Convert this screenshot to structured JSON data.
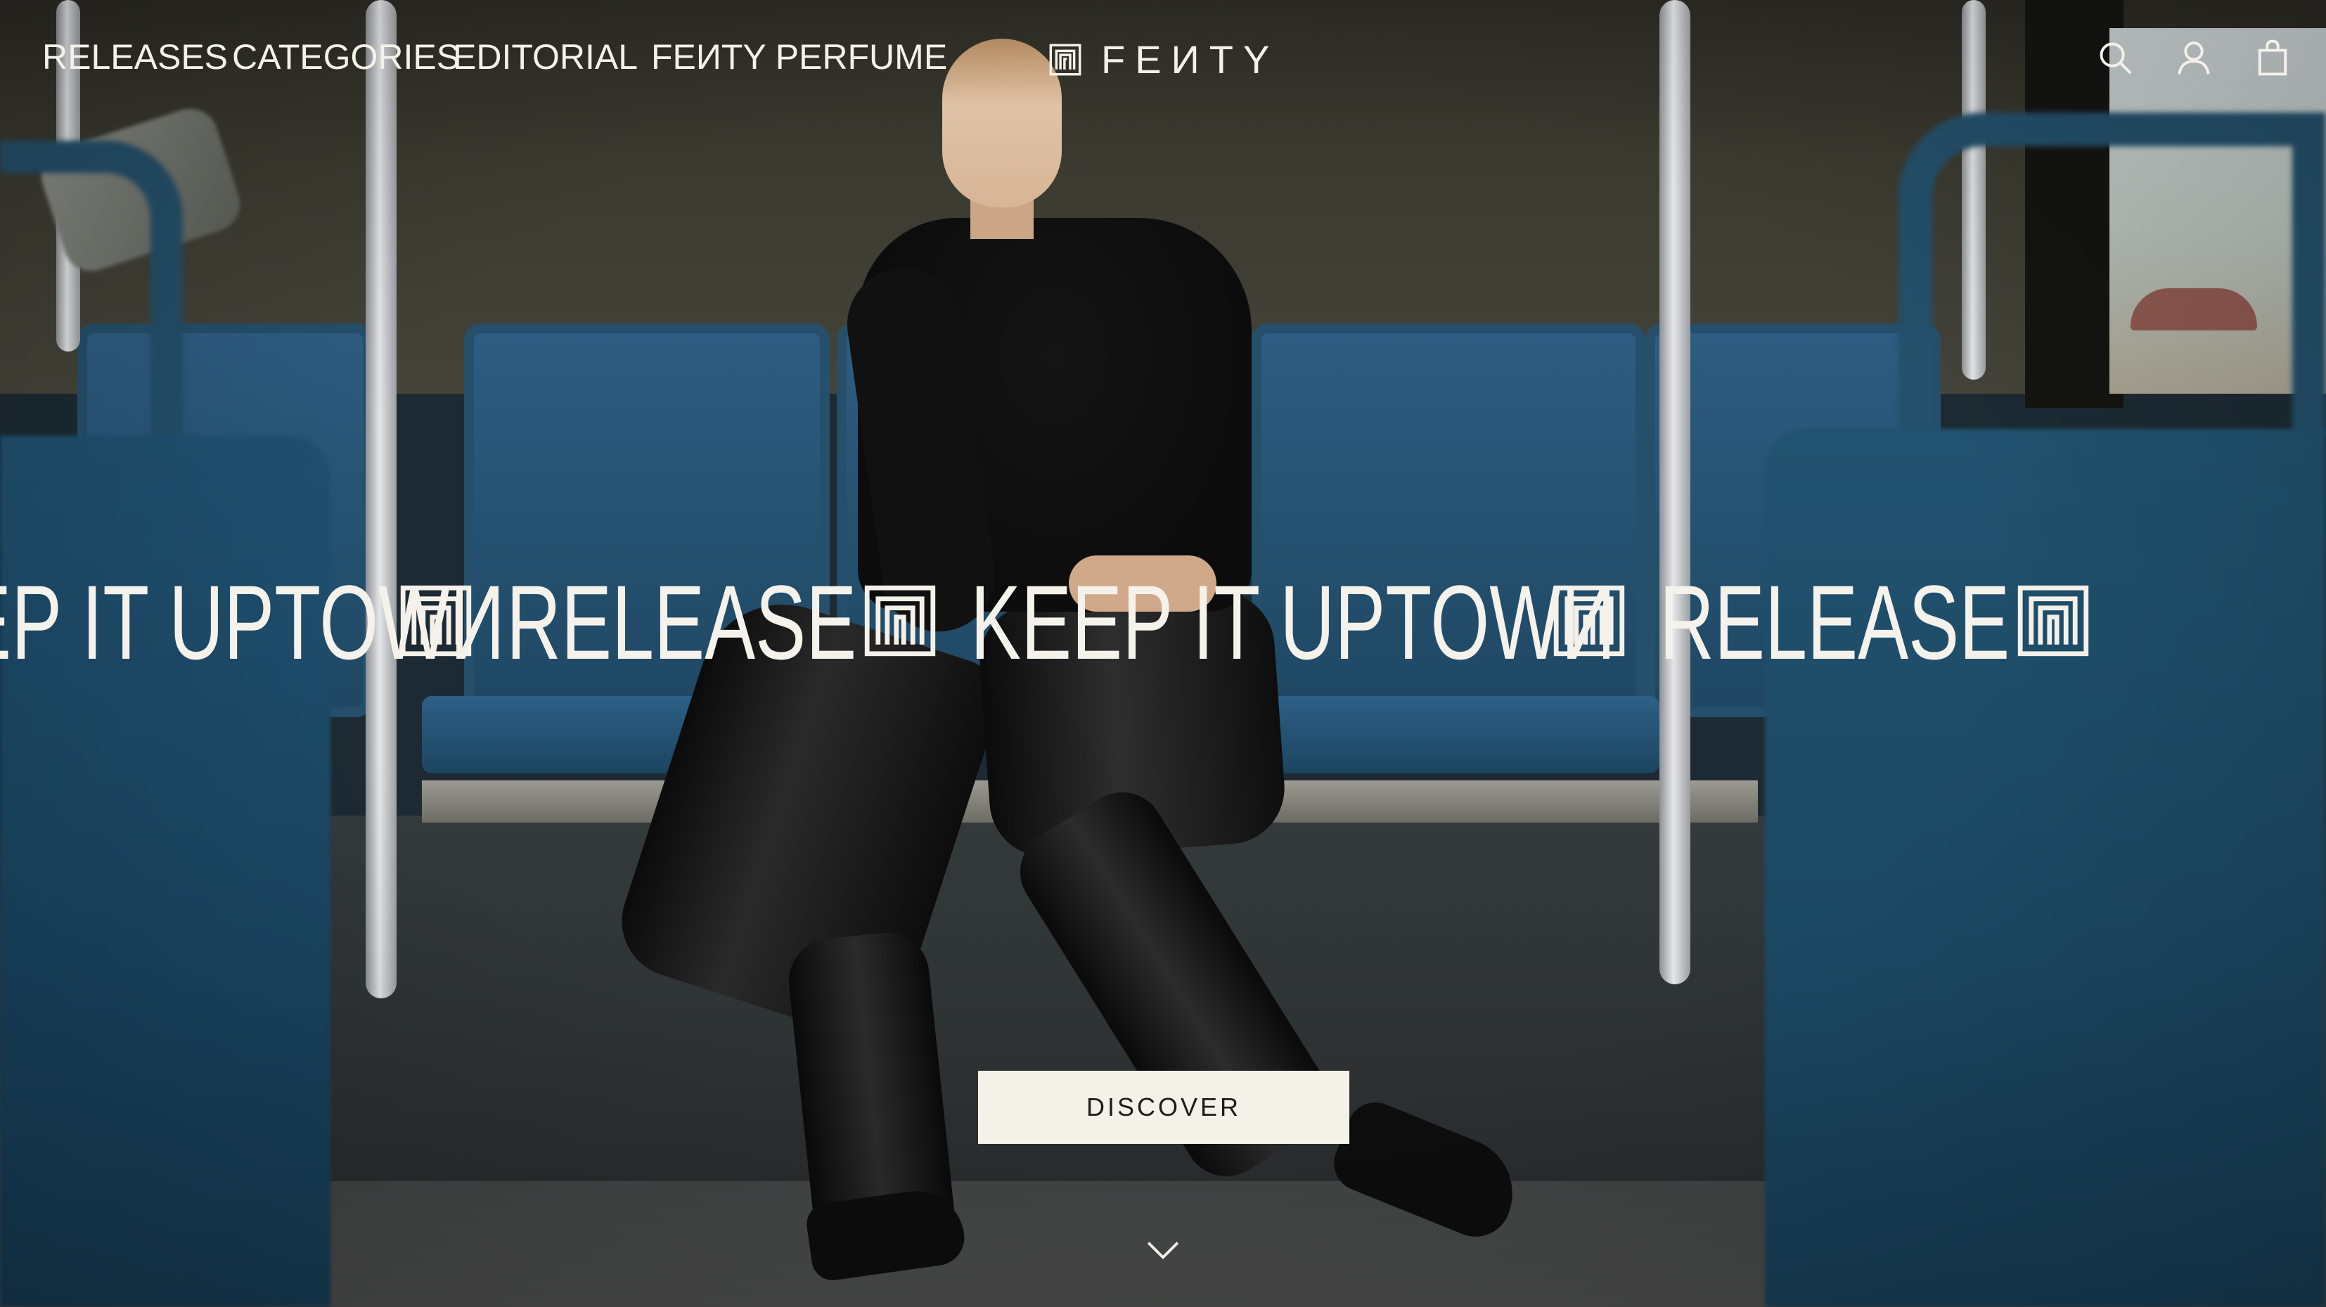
{
  "nav": {
    "items": [
      {
        "label": "RELEASES"
      },
      {
        "label": "CATEGORIES"
      },
      {
        "label": "EDITORIAL"
      },
      {
        "label": "FEИTY PERFUME"
      }
    ]
  },
  "brand": {
    "name": "FEИTY",
    "logo_icon": "fenty-monogram-icon"
  },
  "utility": {
    "search_icon": "search-icon",
    "account_icon": "user-icon",
    "bag_icon": "shopping-bag-icon"
  },
  "hero": {
    "marquee": [
      {
        "text": "KEEP IT UPTOWИ"
      },
      {
        "text": "RELEASE"
      },
      {
        "text": "KEEP IT UPTOWИ"
      },
      {
        "text": "RELEASE"
      }
    ],
    "cta_label": "DISCOVER",
    "scroll_icon": "chevron-down-icon"
  },
  "colors": {
    "text_light": "#f4f1ea",
    "cta_bg": "#f4f1e8",
    "cta_text": "#1c1c1c",
    "seat_blue": "#24516f"
  }
}
